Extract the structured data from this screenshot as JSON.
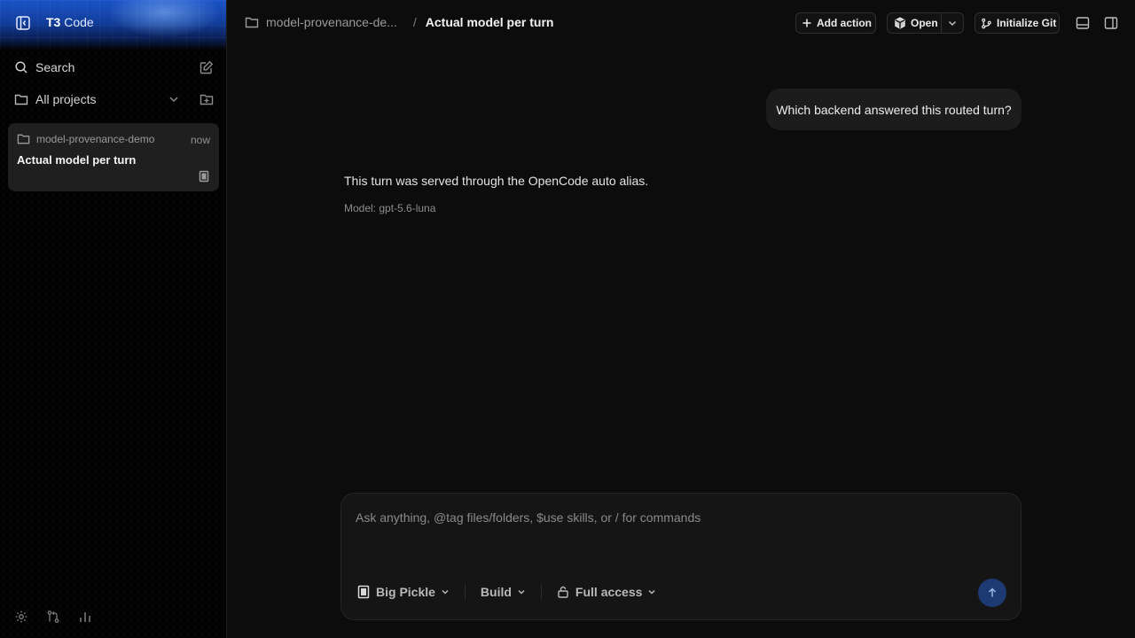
{
  "sidebar": {
    "brand_name": "T3",
    "brand_suffix": "Code",
    "search_label": "Search",
    "projects_label": "All projects",
    "thread": {
      "project": "model-provenance-demo",
      "time": "now",
      "title": "Actual model per turn"
    },
    "footer_icons": [
      "gear-icon",
      "git-compare-icon",
      "bar-chart-icon"
    ]
  },
  "header": {
    "project_crumb": "model-provenance-de...",
    "separator": "/",
    "current_thread": "Actual model per turn",
    "add_action_label": "Add action",
    "open_label": "Open",
    "init_git_label": "Initialize Git"
  },
  "conversation": {
    "user_message": "Which backend answered this routed turn?",
    "assistant_message": "This turn was served through the OpenCode auto alias.",
    "assistant_meta": "Model: gpt-5.6-luna"
  },
  "composer": {
    "placeholder": "Ask anything, @tag files/folders, $use skills, or / for commands",
    "model_label": "Big Pickle",
    "mode_label": "Build",
    "access_label": "Full access"
  },
  "colors": {
    "brand_blue": "#1b53c8",
    "send_button": "#1d3a72",
    "card_bg": "#1f1f1f"
  }
}
